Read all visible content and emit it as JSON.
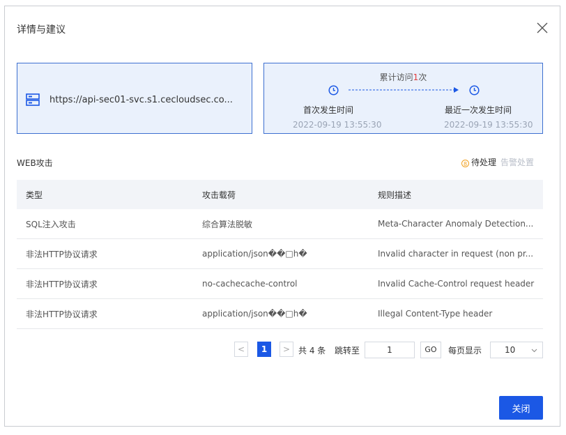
{
  "dialog": {
    "title": "详情与建议"
  },
  "url_card": {
    "url": "https://api-sec01-svc.s1.cecloudsec.co..."
  },
  "visit_card": {
    "visits_prefix": "累计访问",
    "visits_count": "1",
    "visits_suffix": "次",
    "first_label": "首次发生时间",
    "first_time": "2022-09-19 13:55:30",
    "last_label": "最近一次发生时间",
    "last_time": "2022-09-19 13:55:30"
  },
  "section": {
    "title": "WEB攻击",
    "legend_pending": "待处理",
    "legend_done": "告警处置",
    "legend_dot": "⑧"
  },
  "table": {
    "headers": [
      "类型",
      "攻击载荷",
      "规则描述"
    ],
    "rows": [
      [
        "SQL注入攻击",
        "综合算法脱敏",
        "Meta-Character Anomaly Detection..."
      ],
      [
        "非法HTTP协议请求",
        "application/json��□h�",
        "Invalid character in request (non pr..."
      ],
      [
        "非法HTTP协议请求",
        "no-cachecache-control",
        "Invalid Cache-Control request header"
      ],
      [
        "非法HTTP协议请求",
        "application/json��□h�",
        "Illegal Content-Type header"
      ]
    ]
  },
  "pagination": {
    "prev": "<",
    "current_page": "1",
    "next": ">",
    "total": "共 4 条",
    "jump_label": "跳转至",
    "jump_value": "1",
    "go": "GO",
    "per_page_label": "每页显示",
    "per_page_value": "10"
  },
  "footer": {
    "close_label": "关闭"
  },
  "colors": {
    "primary": "#1b58e5",
    "card_border": "#3c6fd0",
    "card_bg": "#eaf1fc",
    "pending": "#f0a020"
  }
}
